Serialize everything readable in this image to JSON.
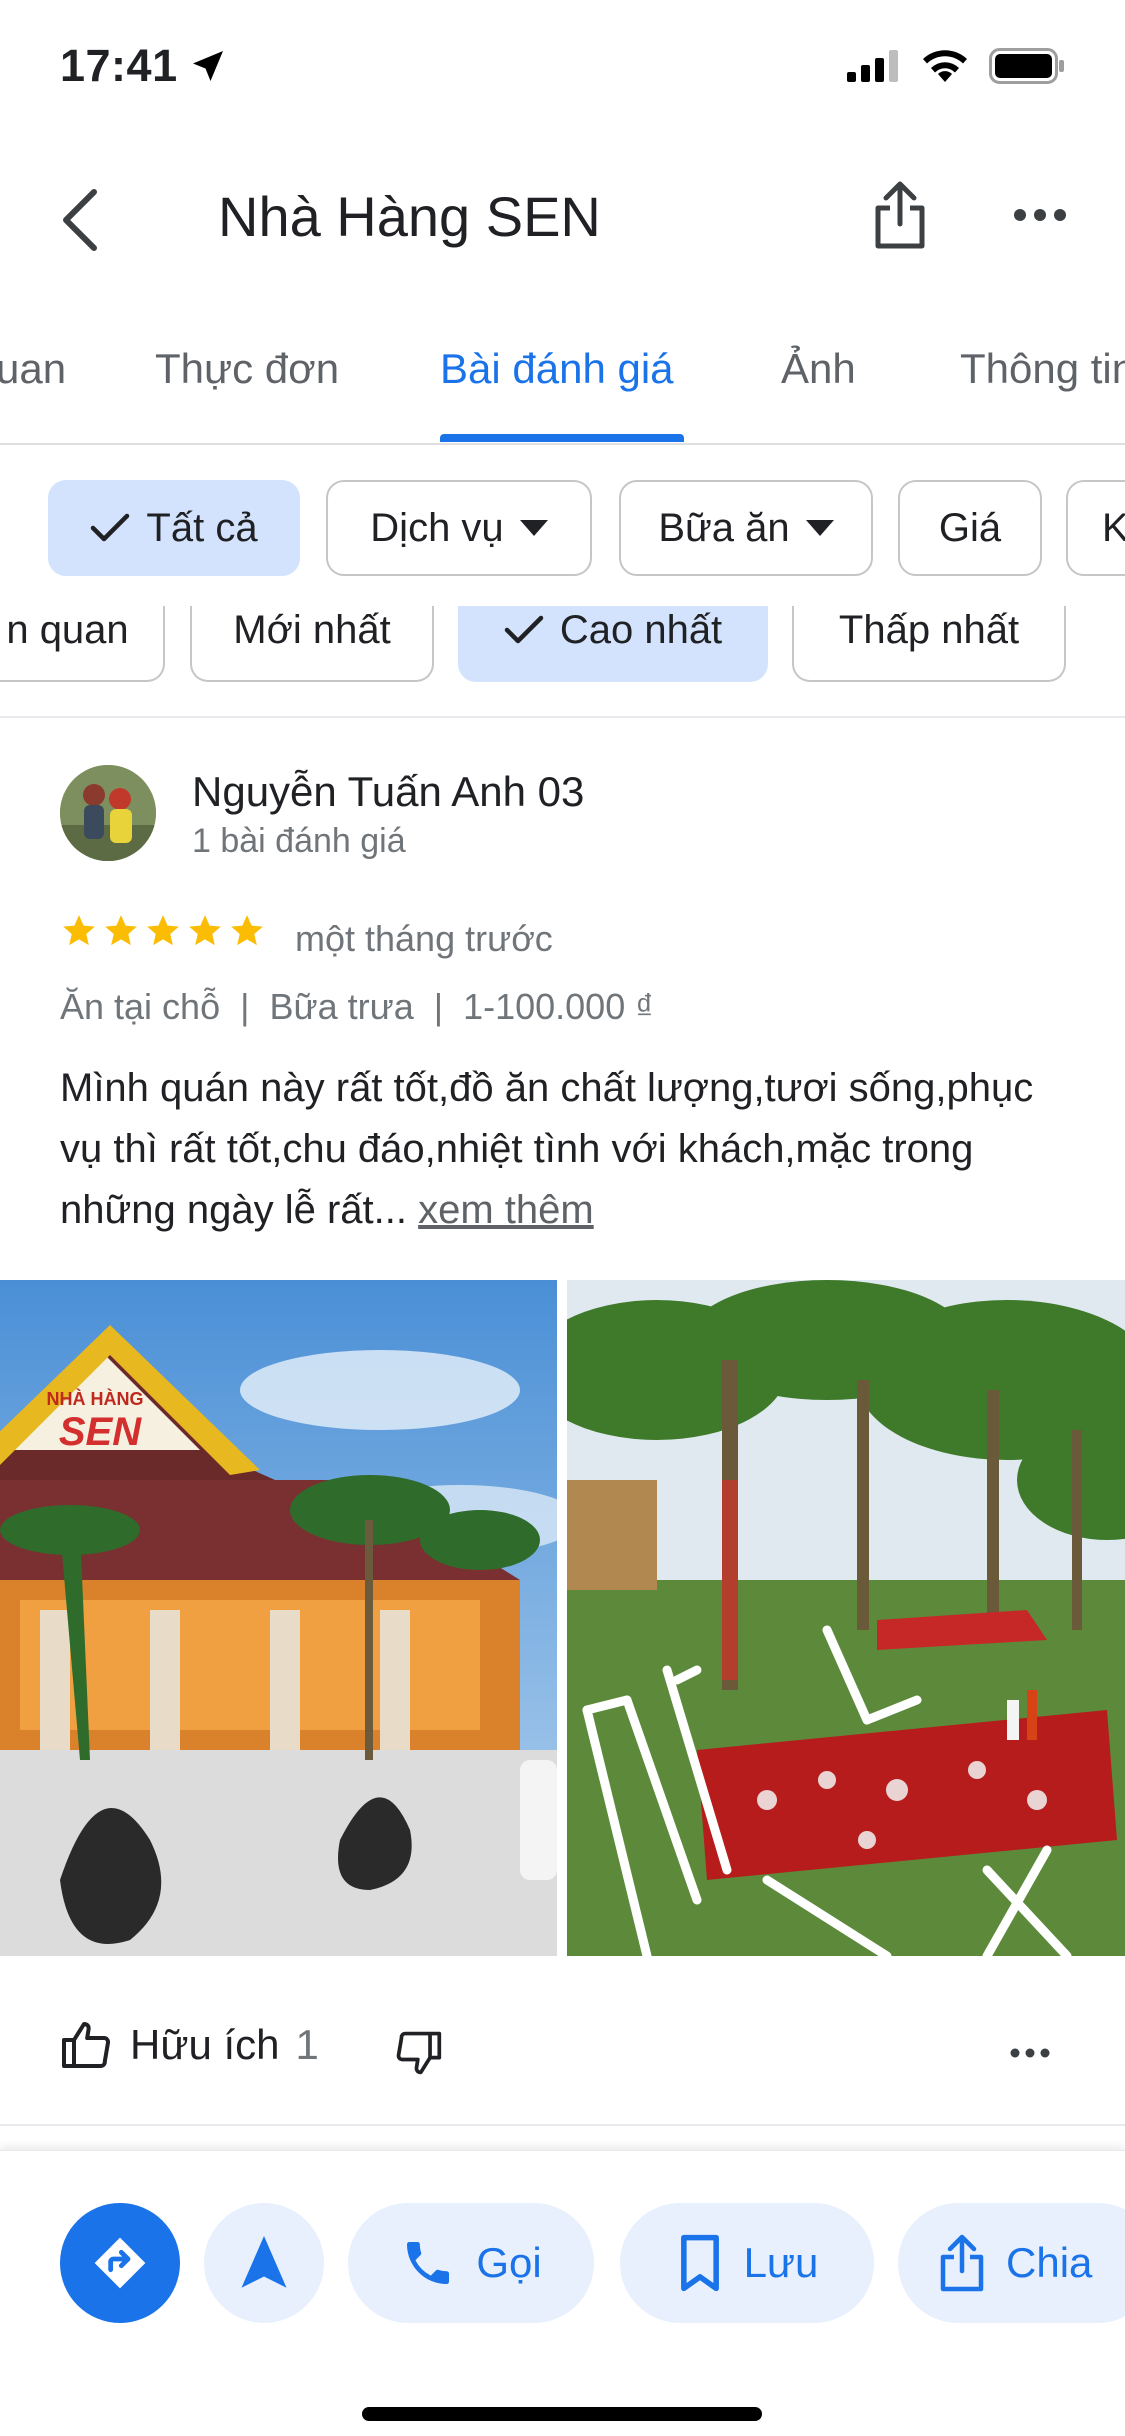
{
  "status_bar": {
    "time": "17:41"
  },
  "header": {
    "title": "Nhà Hàng SEN"
  },
  "tabs": [
    {
      "label": "uan"
    },
    {
      "label": "Thực đơn"
    },
    {
      "label": "Bài đánh giá"
    },
    {
      "label": "Ảnh"
    },
    {
      "label": "Thông tin"
    }
  ],
  "filters_row1": [
    {
      "label": "Tất cả",
      "selected": true
    },
    {
      "label": "Dịch vụ"
    },
    {
      "label": "Bữa ăn"
    },
    {
      "label": "Giá"
    },
    {
      "label": "K"
    }
  ],
  "filters_row2": [
    {
      "label": "n quan"
    },
    {
      "label": "Mới nhất"
    },
    {
      "label": "Cao nhất",
      "selected": true
    },
    {
      "label": "Thấp nhất"
    }
  ],
  "review": {
    "name": "Nguyễn Tuấn Anh 03",
    "review_count": "1 bài đánh giá",
    "rating": 5,
    "time": "một tháng trước",
    "meta": [
      "Ăn tại chỗ",
      "Bữa trưa",
      "1-100.000 ₫"
    ],
    "text": "Mình quán này rất tốt,đồ ăn chất lượng,tươi sống,phục vụ thì rất tốt,chu đáo,nhiệt tình với khách,mặc trong những ngày lễ rất...",
    "more": "xem thêm",
    "photo1_sign_line1": "NHÀ HÀNG",
    "photo1_sign_line2": "SEN",
    "helpful_label": "Hữu ích",
    "helpful_count": "1"
  },
  "bottom_bar": {
    "call": "Gọi",
    "save": "Lưu",
    "share": "Chia"
  },
  "colors": {
    "accent": "#1a73e8",
    "chip_selected": "#d3e3fd",
    "star": "#fbbc04"
  }
}
